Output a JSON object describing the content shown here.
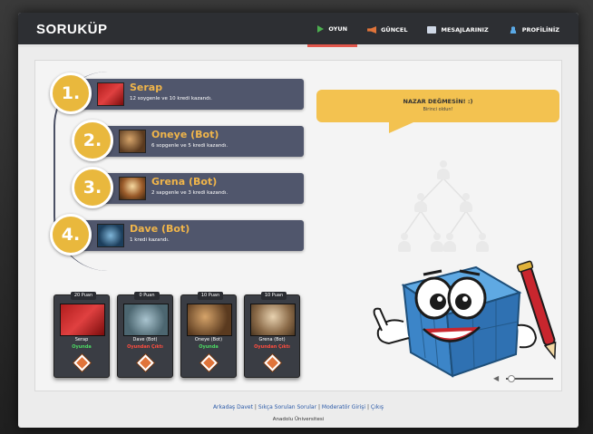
{
  "app": {
    "brand": "SORUKÜP"
  },
  "nav": [
    {
      "label": "OYUN",
      "icon": "play-icon",
      "active": true
    },
    {
      "label": "GÜNCEL",
      "icon": "megaphone-icon"
    },
    {
      "label": "MESAJLARINIZ",
      "icon": "mail-icon"
    },
    {
      "label": "PROFİLİNİZ",
      "icon": "user-icon"
    }
  ],
  "rankings": [
    {
      "rank": "1.",
      "name": "Serap",
      "desc": "12 soygenle ve 10 kredi kazandı."
    },
    {
      "rank": "2.",
      "name": "Oneye (Bot)",
      "desc": "6 sopgenle ve 5 kredi kazandı."
    },
    {
      "rank": "3.",
      "name": "Grena (Bot)",
      "desc": "2 sapgenle ve 3 kredi kazandı."
    },
    {
      "rank": "4.",
      "name": "Dave (Bot)",
      "desc": "1 kredi kazandı."
    }
  ],
  "cards": [
    {
      "score": "20 Puan",
      "name": "Serap",
      "status": "Oyunda",
      "online": true
    },
    {
      "score": "0 Puan",
      "name": "Dave (Bot)",
      "status": "Oyundan Çıktı",
      "online": false
    },
    {
      "score": "10 Puan",
      "name": "Oneye (Bot)",
      "status": "Oyunda",
      "online": true
    },
    {
      "score": "10 Puan",
      "name": "Grena (Bot)",
      "status": "Oyundan Çıktı",
      "online": false
    }
  ],
  "bubble": {
    "title": "NAZAR DEĞMESİN! :)",
    "subtitle": "Birinci oldun!"
  },
  "footer": {
    "links": [
      "Arkadaş Davet",
      "Sıkça Sorulan Sorular",
      "Moderatör Girişi",
      "Çıkış"
    ],
    "org": "Anadolu Üniversitesi"
  },
  "colors": {
    "accent": "#e9b83d",
    "bar": "#50566c",
    "topbar": "#2d2f33",
    "nameGold": "#f0b54a"
  }
}
